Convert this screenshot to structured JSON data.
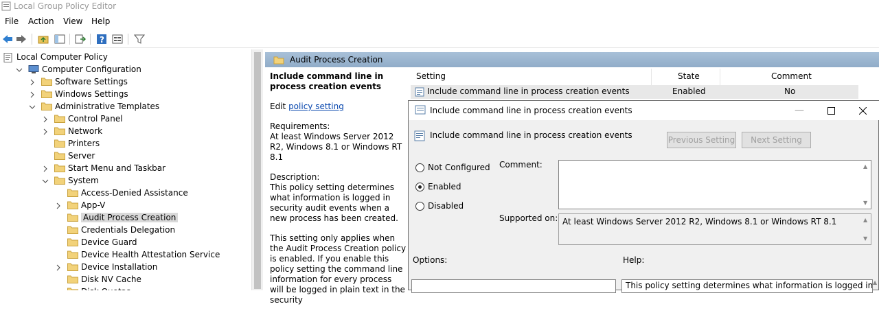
{
  "window": {
    "title": "Local Group Policy Editor"
  },
  "menu": [
    "File",
    "Action",
    "View",
    "Help"
  ],
  "tree": {
    "items": [
      {
        "label": "Local Computer Policy",
        "icon": "scroll-icon",
        "expander": ""
      },
      {
        "label": "Computer Configuration",
        "icon": "computer-icon",
        "expander": "expanded"
      },
      {
        "label": "Software Settings",
        "icon": "folder-icon",
        "expander": "collapsed"
      },
      {
        "label": "Windows Settings",
        "icon": "folder-icon",
        "expander": "collapsed"
      },
      {
        "label": "Administrative Templates",
        "icon": "folder-icon",
        "expander": "expanded"
      },
      {
        "label": "Control Panel",
        "icon": "folder-icon",
        "expander": "collapsed"
      },
      {
        "label": "Network",
        "icon": "folder-icon",
        "expander": "collapsed"
      },
      {
        "label": "Printers",
        "icon": "folder-icon",
        "expander": ""
      },
      {
        "label": "Server",
        "icon": "folder-icon",
        "expander": ""
      },
      {
        "label": "Start Menu and Taskbar",
        "icon": "folder-icon",
        "expander": "collapsed"
      },
      {
        "label": "System",
        "icon": "folder-icon",
        "expander": "expanded"
      },
      {
        "label": "Access-Denied Assistance",
        "icon": "folder-icon",
        "expander": ""
      },
      {
        "label": "App-V",
        "icon": "folder-icon",
        "expander": "collapsed"
      },
      {
        "label": "Audit Process Creation",
        "icon": "folder-icon",
        "expander": "",
        "selected": true
      },
      {
        "label": "Credentials Delegation",
        "icon": "folder-icon",
        "expander": ""
      },
      {
        "label": "Device Guard",
        "icon": "folder-icon",
        "expander": ""
      },
      {
        "label": "Device Health Attestation Service",
        "icon": "folder-icon",
        "expander": ""
      },
      {
        "label": "Device Installation",
        "icon": "folder-icon",
        "expander": "collapsed"
      },
      {
        "label": "Disk NV Cache",
        "icon": "folder-icon",
        "expander": ""
      },
      {
        "label": "Disk Quotas",
        "icon": "folder-icon",
        "expander": ""
      }
    ]
  },
  "pane": {
    "header": "Audit Process Creation",
    "desc_title": "Include command line in process creation events",
    "edit_prefix": "Edit ",
    "edit_link": "policy setting ",
    "requirements_label": "Requirements:",
    "requirements": "At least Windows Server 2012 R2, Windows 8.1 or Windows RT 8.1",
    "description_label": "Description:",
    "description": "This policy setting determines what information is logged in security audit events when a new process has been created.",
    "description2": "This setting only applies when the Audit Process Creation policy is enabled. If you enable this policy setting the command line information for every process will be logged in plain text in the security"
  },
  "list": {
    "columns": [
      "Setting",
      "State",
      "Comment"
    ],
    "rows": [
      {
        "setting": "Include command line in process creation events",
        "state": "Enabled",
        "comment": "No"
      }
    ]
  },
  "dialog": {
    "title": "Include command line in process creation events",
    "setting_name": "Include command line in process creation events",
    "prev_label": "Previous Setting",
    "next_label": "Next Setting",
    "options": [
      "Not Configured",
      "Enabled",
      "Disabled"
    ],
    "selected_option": "Enabled",
    "comment_label": "Comment:",
    "comment_value": "",
    "supported_label": "Supported on:",
    "supported_value": "At least Windows Server 2012 R2, Windows 8.1 or Windows RT 8.1",
    "options_label": "Options:",
    "help_label": "Help:",
    "help_text": "This policy setting determines what information is logged in"
  },
  "colors": {
    "header": "#9fb8d0",
    "selection": "#d9d9d9",
    "link": "#0645ad"
  }
}
